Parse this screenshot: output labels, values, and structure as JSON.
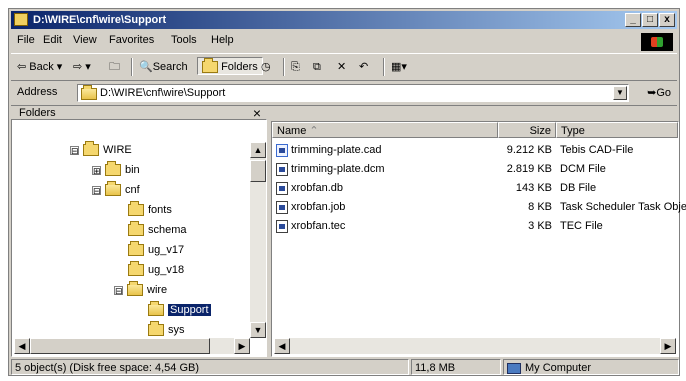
{
  "window": {
    "title": "D:\\WIRE\\cnf\\wire\\Support",
    "min": "_",
    "max": "□",
    "close": "x"
  },
  "menu": [
    "File",
    "Edit",
    "View",
    "Favorites",
    "Tools",
    "Help"
  ],
  "toolbar": {
    "back": "Back",
    "search": "Search",
    "folders": "Folders"
  },
  "address": {
    "label": "Address",
    "value": "D:\\WIRE\\cnf\\wire\\Support",
    "go": "Go"
  },
  "folders_pane": {
    "title": "Folders",
    "close": "×",
    "tree": [
      {
        "label": "WIRE",
        "expander": "⊟"
      },
      {
        "label": "bin",
        "expander": "⊞"
      },
      {
        "label": "cnf",
        "expander": "⊟"
      },
      {
        "label": "fonts"
      },
      {
        "label": "schema"
      },
      {
        "label": "ug_v17"
      },
      {
        "label": "ug_v18"
      },
      {
        "label": "wire",
        "expander": "⊟"
      },
      {
        "label": "Support",
        "selected": true
      },
      {
        "label": "sys"
      }
    ]
  },
  "list": {
    "columns": [
      "Name",
      "Size",
      "Type"
    ],
    "rows": [
      {
        "name": "trimming-plate.cad",
        "size": "9.212 KB",
        "type": "Tebis CAD-File",
        "icon": "cad-file-icon"
      },
      {
        "name": "trimming-plate.dcm",
        "size": "2.819 KB",
        "type": "DCM File",
        "icon": "file-icon"
      },
      {
        "name": "xrobfan.db",
        "size": "143 KB",
        "type": "DB File",
        "icon": "file-icon"
      },
      {
        "name": "xrobfan.job",
        "size": "8 KB",
        "type": "Task Scheduler Task Object",
        "icon": "file-icon"
      },
      {
        "name": "xrobfan.tec",
        "size": "3 KB",
        "type": "TEC File",
        "icon": "file-icon"
      }
    ]
  },
  "status": {
    "objects": "5 object(s) (Disk free space: 4,54 GB)",
    "size": "11,8 MB",
    "location": "My Computer"
  }
}
